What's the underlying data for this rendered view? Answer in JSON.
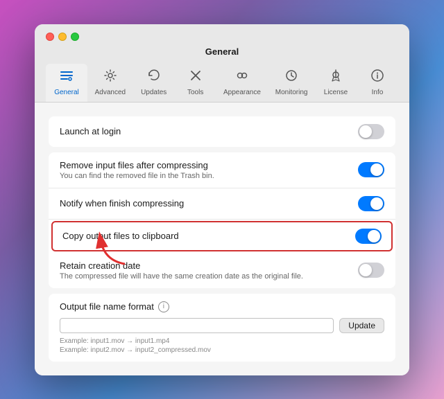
{
  "window": {
    "title": "General"
  },
  "tabs": [
    {
      "id": "general",
      "label": "General",
      "icon": "⚙",
      "active": true
    },
    {
      "id": "advanced",
      "label": "Advanced",
      "icon": "⚙",
      "active": false
    },
    {
      "id": "updates",
      "label": "Updates",
      "icon": "↻",
      "active": false
    },
    {
      "id": "tools",
      "label": "Tools",
      "icon": "✕",
      "active": false
    },
    {
      "id": "appearance",
      "label": "Appearance",
      "icon": "◉",
      "active": false
    },
    {
      "id": "monitoring",
      "label": "Monitoring",
      "icon": "⌚",
      "active": false
    },
    {
      "id": "license",
      "label": "License",
      "icon": "🔑",
      "active": false
    },
    {
      "id": "info",
      "label": "Info",
      "icon": "ℹ",
      "active": false
    }
  ],
  "settings": {
    "launch_at_login": {
      "label": "Launch at login",
      "enabled": false
    },
    "remove_input_files": {
      "label": "Remove input files after compressing",
      "sublabel": "You can find the removed file in the Trash bin.",
      "enabled": true
    },
    "notify_finish": {
      "label": "Notify when finish compressing",
      "enabled": true
    },
    "copy_output": {
      "label": "Copy output files to clipboard",
      "enabled": true,
      "highlighted": true
    },
    "retain_creation_date": {
      "label": "Retain creation date",
      "sublabel": "The compressed file will have the same creation date as the original file.",
      "enabled": false
    },
    "output_format": {
      "label": "Output file name format",
      "placeholder": "",
      "update_button": "Update",
      "examples": [
        "Example: input1.mov → input1.mp4",
        "Example: input2.mov → input2_compressed.mov"
      ]
    }
  }
}
